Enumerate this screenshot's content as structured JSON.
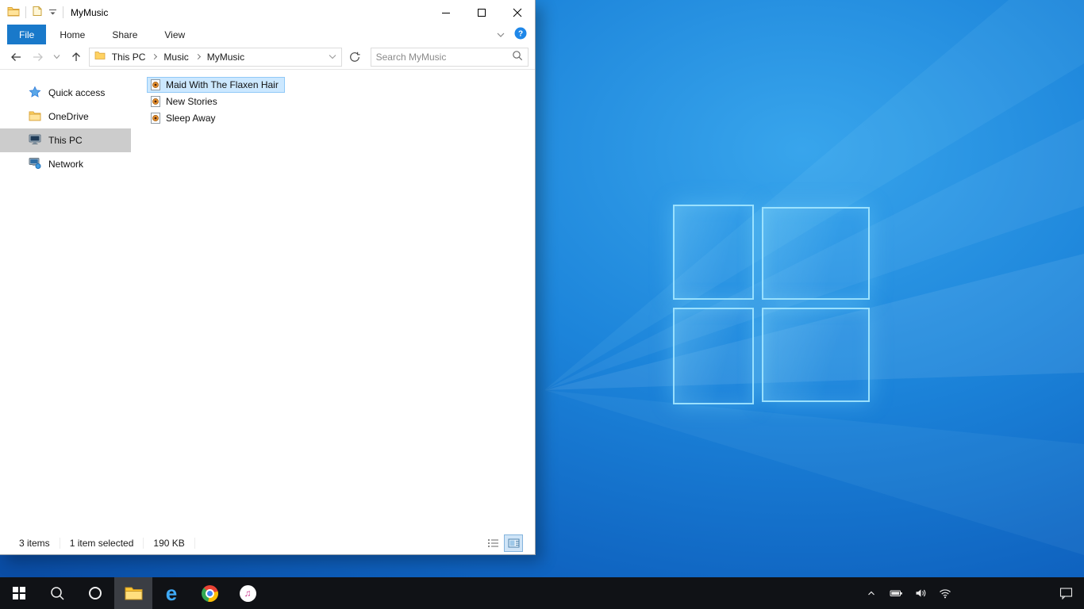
{
  "titlebar": {
    "title": "MyMusic"
  },
  "ribbon": {
    "tabs": [
      "File",
      "Home",
      "Share",
      "View"
    ],
    "help_glyph": "?"
  },
  "addressbar": {
    "crumbs": [
      "This PC",
      "Music",
      "MyMusic"
    ],
    "search_placeholder": "Search MyMusic"
  },
  "sidebar": {
    "items": [
      {
        "label": "Quick access",
        "icon": "star-icon"
      },
      {
        "label": "OneDrive",
        "icon": "onedrive-folder-icon"
      },
      {
        "label": "This PC",
        "icon": "computer-icon",
        "selected": true
      },
      {
        "label": "Network",
        "icon": "network-icon"
      }
    ]
  },
  "filelist": {
    "items": [
      {
        "name": "Maid With The Flaxen Hair",
        "icon": "audio-file-icon",
        "selected": true
      },
      {
        "name": "New Stories",
        "icon": "audio-file-icon",
        "selected": false
      },
      {
        "name": "Sleep Away",
        "icon": "audio-file-icon",
        "selected": false
      }
    ]
  },
  "statusbar": {
    "count": "3 items",
    "selection": "1 item selected",
    "size": "190 KB"
  },
  "taskbar": {
    "icons": [
      "start",
      "search",
      "cortana",
      "file-explorer",
      "edge",
      "chrome",
      "itunes"
    ],
    "tray_icons": [
      "show-hidden",
      "battery",
      "speaker",
      "wifi",
      "action-center"
    ],
    "edge_glyph": "e",
    "itunes_glyph": "♫"
  },
  "colors": {
    "accent": "#1979ca",
    "selection_bg": "#cce8ff",
    "selection_border": "#91c9f7",
    "nav_selected_bg": "#cccccc",
    "taskbar_bg": "#101216",
    "wallpaper_blue": "#1c84da"
  }
}
